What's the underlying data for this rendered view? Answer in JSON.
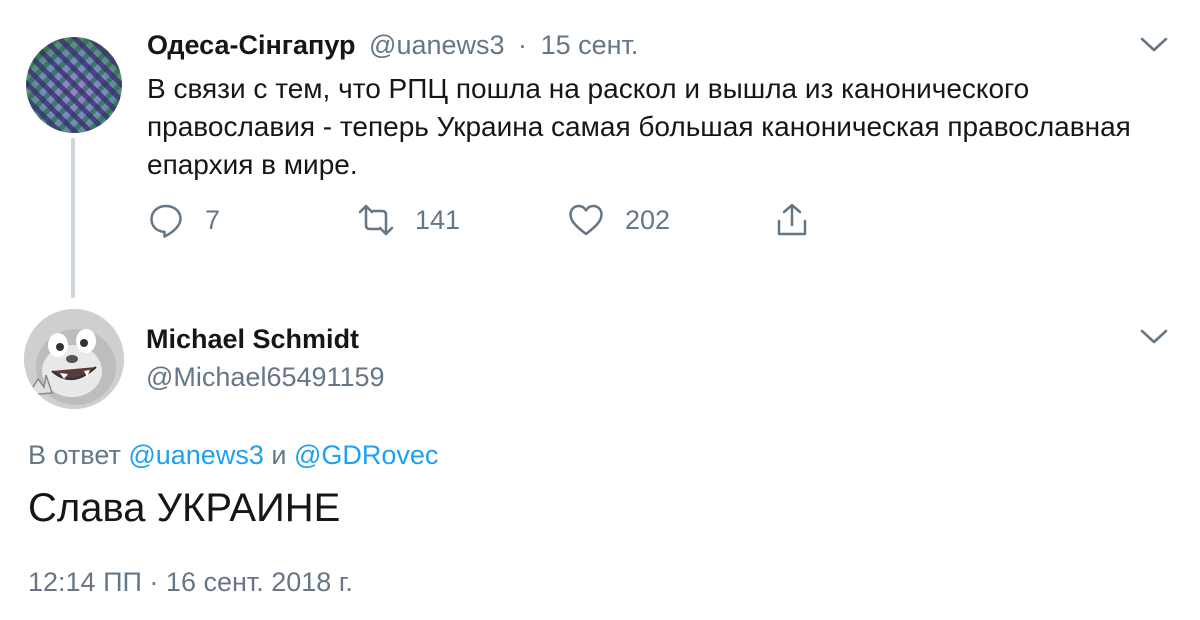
{
  "parent_tweet": {
    "display_name": "Одеса-Сінгапур",
    "handle": "@uanews3",
    "separator": "·",
    "date": "15 сент.",
    "text": "В связи с тем, что РПЦ пошла на раскол и вышла из канонического православия - теперь Украина самая большая каноническая православная епархия в мире.",
    "replies": "7",
    "retweets": "141",
    "likes": "202",
    "icons": [
      "reply-icon",
      "retweet-icon",
      "like-icon",
      "share-icon",
      "chevron-down-icon"
    ]
  },
  "reply_tweet": {
    "display_name": "Michael Schmidt",
    "handle": "@Michael65491159",
    "context_prefix": "В ответ",
    "mention_1": "@uanews3",
    "context_and": "и",
    "mention_2": "@GDRovec",
    "text": "Слава УКРАИНЕ",
    "time": "12:14 ПП",
    "separator": "·",
    "date": "16 сент. 2018 г."
  },
  "colors": {
    "text": "#14171a",
    "muted": "#657786",
    "link": "#1da1f2",
    "thread_line": "#ccd6dd"
  }
}
